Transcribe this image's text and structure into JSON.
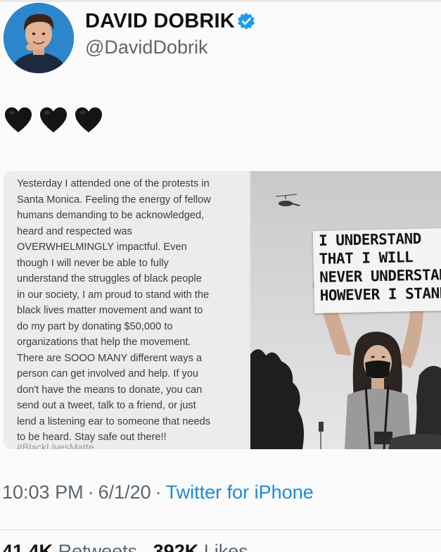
{
  "header": {
    "display_name": "DAVID DOBRIK",
    "handle": "@DavidDobrik",
    "verified_icon": "verified-badge-icon"
  },
  "tweet": {
    "hearts": "🖤🖤🖤",
    "heart_count": 3,
    "heart_icon": "black-heart-icon"
  },
  "media": {
    "note_text": "Yesterday I attended one of the protests in\nSanta Monica. Feeling the energy of fellow\nhumans demanding to be acknowledged,\nheard and respected was\nOVERWHELMINGLY impactful. Even\nthough I will never be able to fully\nunderstand the struggles of black people\nin our society, I am proud to stand with the\nblack lives matter movement and want to\ndo my part by donating $50,000 to\norganizations that help the movement.\nThere are SOOO MANY different ways a\nperson can get involved and help. If you\ndon't have the means to donate, you can\nsend out a tweet, talk to a friend, or just\nlend a listening ear to someone that needs\nto be heard. Stay safe out there!!",
    "note_cutoff": "#BlackLivesMatter",
    "sign_lines": [
      "I UNDERSTAND",
      "THAT I WILL",
      "NEVER UNDERSTAND",
      "HOWEVER I STAND"
    ]
  },
  "meta": {
    "time": "10:03 PM",
    "date": "6/1/20",
    "separator": "·",
    "source": "Twitter for iPhone"
  },
  "stats": {
    "retweets_count": "41.4K",
    "retweets_label": "Retweets",
    "likes_count": "392K",
    "likes_label": "Likes"
  },
  "colors": {
    "link_blue": "#1d8bd8",
    "verified_blue": "#1d9bf0",
    "muted_text": "#5b6670"
  }
}
